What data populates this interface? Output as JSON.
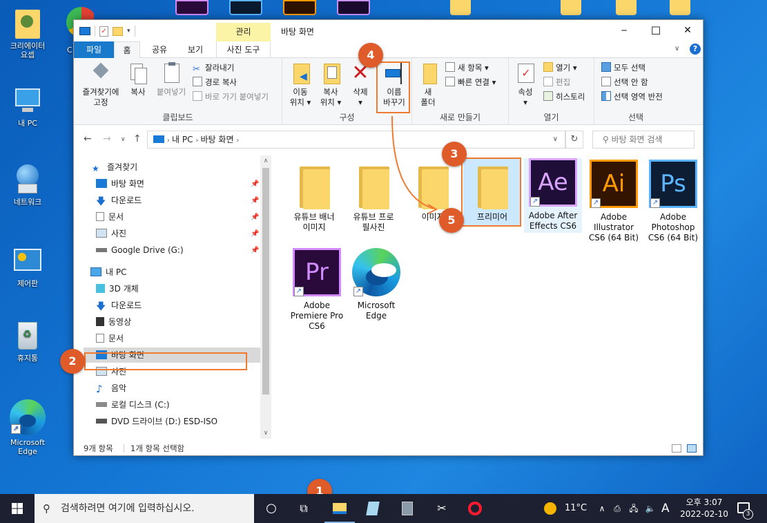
{
  "desktop": {
    "icons": [
      {
        "label": "크리에이터\n요셉"
      },
      {
        "label": "내 PC"
      },
      {
        "label": "네트워크"
      },
      {
        "label": "제어판"
      },
      {
        "label": "휴지통"
      },
      {
        "label": "Microsoft\nEdge"
      }
    ],
    "partial_label": "C"
  },
  "window": {
    "title": "바탕 화면",
    "context_tab": "관리",
    "controls": {
      "minimize": "─",
      "maximize": "☐",
      "close": "✕"
    }
  },
  "tabs": [
    "파일",
    "홈",
    "공유",
    "보기",
    "사진 도구"
  ],
  "ribbon": {
    "clipboard": {
      "label": "클립보드",
      "pin": "즐겨찾기에\n고정",
      "copy": "복사",
      "paste": "붙여넣기",
      "cut": "잘라내기",
      "copy_path": "경로 복사",
      "paste_shortcut": "바로 가기 붙여넣기"
    },
    "organize": {
      "label": "구성",
      "move": "이동\n위치 ▾",
      "copyto": "복사\n위치 ▾",
      "delete": "삭제\n▾",
      "rename": "이름\n바꾸기"
    },
    "new": {
      "label": "새로 만들기",
      "new_folder": "새\n폴더",
      "new_item": "새 항목 ▾",
      "easy_access": "빠른 연결 ▾"
    },
    "open": {
      "label": "열기",
      "properties": "속성\n▾",
      "open": "열기 ▾",
      "edit": "편집",
      "history": "히스토리"
    },
    "select": {
      "label": "선택",
      "all": "모두 선택",
      "none": "선택 안 함",
      "invert": "선택 영역 반전"
    }
  },
  "address": {
    "path": [
      "내 PC",
      "바탕 화면"
    ],
    "search_placeholder": "바탕 화면 검색"
  },
  "navpane": {
    "quick_access": "즐겨찾기",
    "quick_items": [
      "바탕 화면",
      "다운로드",
      "문서",
      "사진",
      "Google Drive (G:)"
    ],
    "this_pc": "내 PC",
    "pc_items": [
      "3D 개체",
      "다운로드",
      "동영상",
      "문서",
      "바탕 화면",
      "사진",
      "음악",
      "로컬 디스크 (C:)",
      "DVD 드라이브 (D:) ESD-ISO"
    ]
  },
  "files": [
    {
      "name": "유튜브 배너\n이미지",
      "type": "folder"
    },
    {
      "name": "유튜브 프로\n필사진",
      "type": "folder"
    },
    {
      "name": "이미지 ",
      "type": "folder"
    },
    {
      "name": "프리미어",
      "type": "folder"
    },
    {
      "name": "Adobe After\nEffects CS6",
      "type": "ae",
      "badge": "Ae"
    },
    {
      "name": "Adobe\nIllustrator\nCS6 (64 Bit)",
      "type": "ai",
      "badge": "Ai"
    },
    {
      "name": "Adobe\nPhotoshop\nCS6 (64 Bit)",
      "type": "ps",
      "badge": "Ps"
    },
    {
      "name": "Adobe\nPremiere Pro\nCS6",
      "type": "pr",
      "badge": "Pr"
    },
    {
      "name": "Microsoft\nEdge",
      "type": "edge"
    }
  ],
  "status": {
    "count": "9개 항목",
    "selected": "1개 항목 선택함"
  },
  "taskbar": {
    "search_placeholder": "검색하려면 여기에 입력하십시오.",
    "weather": "11°C",
    "ime": "A",
    "time": "오후 3:07",
    "date": "2022-02-10",
    "notif_count": "3"
  },
  "callouts": [
    "1",
    "2",
    "3",
    "4",
    "5"
  ],
  "colors": {
    "accent": "#1979ca",
    "callout": "#e05b2a",
    "highlight": "#f07a30",
    "selected": "#cce8ff"
  }
}
